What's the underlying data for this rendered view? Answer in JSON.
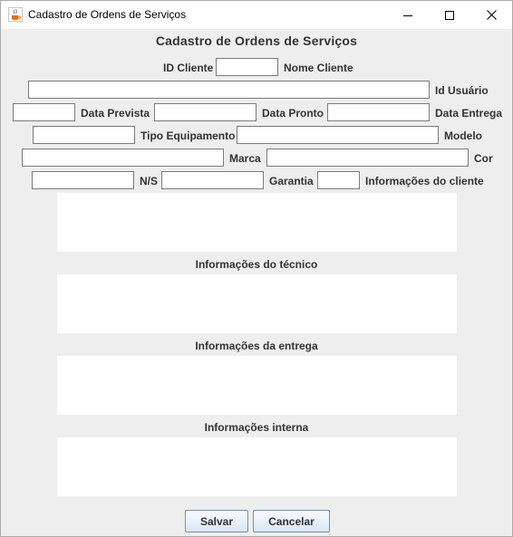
{
  "window": {
    "title": "Cadastro de Ordens de Serviços",
    "icon": "java-coffee-cup-icon"
  },
  "form": {
    "heading": "Cadastro de Ordens de Serviços",
    "labels": {
      "id_cliente": "ID Cliente",
      "nome_cliente": "Nome Cliente",
      "id_usuario": "Id Usuário",
      "data_prevista": "Data Prevista",
      "data_pronto": "Data Pronto",
      "data_entrega": "Data Entrega",
      "tipo_equipamento": "Tipo Equipamento",
      "modelo": "Modelo",
      "marca": "Marca",
      "cor": "Cor",
      "ns": "N/S",
      "garantia": "Garantia",
      "info_cliente": "Informações do cliente",
      "info_tecnico": "Informações do técnico",
      "info_entrega": "Informações da entrega",
      "info_interna": "Informações interna"
    },
    "values": {
      "id_cliente": "",
      "nome_cliente": "",
      "id_usuario": "",
      "data_prevista": "",
      "data_pronto": "",
      "data_entrega": "",
      "tipo_equipamento": "",
      "modelo": "",
      "marca": "",
      "cor": "",
      "ns": "",
      "garantia": "",
      "info_cliente": "",
      "info_tecnico": "",
      "info_entrega": "",
      "info_interna": ""
    }
  },
  "buttons": {
    "save": "Salvar",
    "cancel": "Cancelar"
  }
}
